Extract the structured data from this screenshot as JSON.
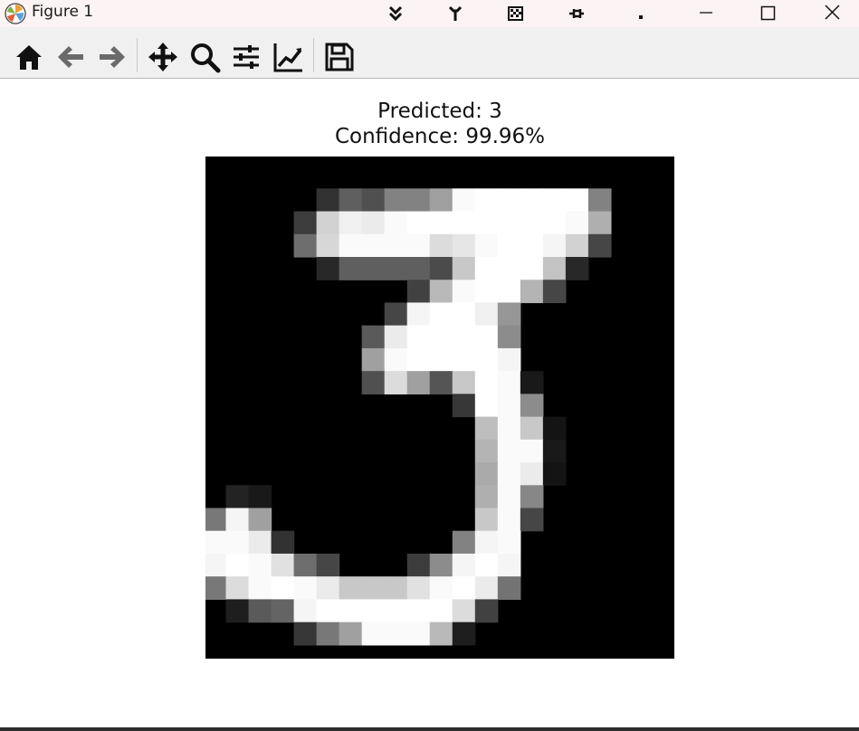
{
  "window": {
    "title": "Figure 1",
    "extra_toolbar_icons": [
      "double-chevron-down-icon",
      "tools-icon",
      "checker-grid-icon",
      "pin-icon",
      "dot-icon"
    ],
    "controls": [
      "minimize-icon",
      "maximize-icon",
      "close-icon"
    ]
  },
  "toolbar": {
    "tools": [
      "home-icon",
      "back-arrow-icon",
      "forward-arrow-icon",
      "pan-icon",
      "zoom-icon",
      "configure-subplots-icon",
      "edit-axis-icon",
      "save-icon"
    ]
  },
  "figure": {
    "title_line1": "Predicted: 3",
    "title_line2": "Confidence: 99.96%",
    "image": {
      "colormap": "gray",
      "rows": [
        "0000000000000000000000000000",
        "0000000000000000000000000000",
        "0000000000000000000000000000",
        "0000000000000000000000000000",
        "0000000000000000000000000000",
        "0000000000000000000000000000",
        "0000000000000000000000000000",
        "0000000000000000000000000000",
        "0000000000000000000000000000",
        "0000000000000000000000000000",
        "0000000000000000000000000000",
        "0000000000000000000000000000",
        "0000000000000000000000000000",
        "0000000000000000000000000000",
        "0000000000000000000000000000",
        "0000000000000000000000000000",
        "0000000000000000000000000000",
        "0000000000000000000000000000",
        "0000000000000000000000000000",
        "0000000000000000000000000000",
        "0000000000000000000000000000",
        "0000000000000000000000000000",
        "0000000000000000000000000000",
        "0000000000000000000000000000",
        "0000000000000000000000000000",
        "0000000000000000000000000000",
        "0000000000000000000000000000",
        "0000000000000000000000000000"
      ],
      "pixels": [
        {
          "r": 1,
          "c": 5,
          "v": 50
        },
        {
          "r": 1,
          "c": 6,
          "v": 95
        },
        {
          "r": 1,
          "c": 7,
          "v": 80
        },
        {
          "r": 1,
          "c": 8,
          "v": 130
        },
        {
          "r": 1,
          "c": 9,
          "v": 130
        },
        {
          "r": 1,
          "c": 10,
          "v": 160
        },
        {
          "r": 1,
          "c": 11,
          "v": 250
        },
        {
          "r": 1,
          "c": 12,
          "v": 255
        },
        {
          "r": 1,
          "c": 13,
          "v": 255
        },
        {
          "r": 1,
          "c": 14,
          "v": 255
        },
        {
          "r": 1,
          "c": 15,
          "v": 255
        },
        {
          "r": 1,
          "c": 16,
          "v": 255
        },
        {
          "r": 1,
          "c": 17,
          "v": 130
        },
        {
          "r": 2,
          "c": 4,
          "v": 60
        },
        {
          "r": 2,
          "c": 5,
          "v": 210
        },
        {
          "r": 2,
          "c": 6,
          "v": 240
        },
        {
          "r": 2,
          "c": 7,
          "v": 235
        },
        {
          "r": 2,
          "c": 8,
          "v": 250
        },
        {
          "r": 2,
          "c": 9,
          "v": 255
        },
        {
          "r": 2,
          "c": 10,
          "v": 255
        },
        {
          "r": 2,
          "c": 11,
          "v": 255
        },
        {
          "r": 2,
          "c": 12,
          "v": 255
        },
        {
          "r": 2,
          "c": 13,
          "v": 255
        },
        {
          "r": 2,
          "c": 14,
          "v": 255
        },
        {
          "r": 2,
          "c": 15,
          "v": 255
        },
        {
          "r": 2,
          "c": 16,
          "v": 250
        },
        {
          "r": 2,
          "c": 17,
          "v": 175
        },
        {
          "r": 3,
          "c": 4,
          "v": 110
        },
        {
          "r": 3,
          "c": 5,
          "v": 215
        },
        {
          "r": 3,
          "c": 6,
          "v": 250
        },
        {
          "r": 3,
          "c": 7,
          "v": 250
        },
        {
          "r": 3,
          "c": 8,
          "v": 250
        },
        {
          "r": 3,
          "c": 9,
          "v": 250
        },
        {
          "r": 3,
          "c": 10,
          "v": 220
        },
        {
          "r": 3,
          "c": 11,
          "v": 230
        },
        {
          "r": 3,
          "c": 12,
          "v": 250
        },
        {
          "r": 3,
          "c": 13,
          "v": 255
        },
        {
          "r": 3,
          "c": 14,
          "v": 255
        },
        {
          "r": 3,
          "c": 15,
          "v": 245
        },
        {
          "r": 3,
          "c": 16,
          "v": 210
        },
        {
          "r": 3,
          "c": 17,
          "v": 70
        },
        {
          "r": 4,
          "c": 5,
          "v": 40
        },
        {
          "r": 4,
          "c": 6,
          "v": 95
        },
        {
          "r": 4,
          "c": 7,
          "v": 95
        },
        {
          "r": 4,
          "c": 8,
          "v": 95
        },
        {
          "r": 4,
          "c": 9,
          "v": 95
        },
        {
          "r": 4,
          "c": 10,
          "v": 75
        },
        {
          "r": 4,
          "c": 11,
          "v": 200
        },
        {
          "r": 4,
          "c": 12,
          "v": 255
        },
        {
          "r": 4,
          "c": 13,
          "v": 255
        },
        {
          "r": 4,
          "c": 14,
          "v": 255
        },
        {
          "r": 4,
          "c": 15,
          "v": 195
        },
        {
          "r": 4,
          "c": 16,
          "v": 40
        },
        {
          "r": 5,
          "c": 9,
          "v": 65
        },
        {
          "r": 5,
          "c": 10,
          "v": 185
        },
        {
          "r": 5,
          "c": 11,
          "v": 250
        },
        {
          "r": 5,
          "c": 12,
          "v": 255
        },
        {
          "r": 5,
          "c": 13,
          "v": 255
        },
        {
          "r": 5,
          "c": 14,
          "v": 180
        },
        {
          "r": 5,
          "c": 15,
          "v": 70
        },
        {
          "r": 6,
          "c": 8,
          "v": 70
        },
        {
          "r": 6,
          "c": 9,
          "v": 245
        },
        {
          "r": 6,
          "c": 10,
          "v": 255
        },
        {
          "r": 6,
          "c": 11,
          "v": 255
        },
        {
          "r": 6,
          "c": 12,
          "v": 240
        },
        {
          "r": 6,
          "c": 13,
          "v": 150
        },
        {
          "r": 7,
          "c": 7,
          "v": 90
        },
        {
          "r": 7,
          "c": 8,
          "v": 235
        },
        {
          "r": 7,
          "c": 9,
          "v": 255
        },
        {
          "r": 7,
          "c": 10,
          "v": 255
        },
        {
          "r": 7,
          "c": 11,
          "v": 255
        },
        {
          "r": 7,
          "c": 12,
          "v": 255
        },
        {
          "r": 7,
          "c": 13,
          "v": 140
        },
        {
          "r": 8,
          "c": 7,
          "v": 160
        },
        {
          "r": 8,
          "c": 8,
          "v": 250
        },
        {
          "r": 8,
          "c": 9,
          "v": 255
        },
        {
          "r": 8,
          "c": 10,
          "v": 255
        },
        {
          "r": 8,
          "c": 11,
          "v": 255
        },
        {
          "r": 8,
          "c": 12,
          "v": 255
        },
        {
          "r": 8,
          "c": 13,
          "v": 245
        },
        {
          "r": 9,
          "c": 7,
          "v": 80
        },
        {
          "r": 9,
          "c": 8,
          "v": 220
        },
        {
          "r": 9,
          "c": 9,
          "v": 160
        },
        {
          "r": 9,
          "c": 10,
          "v": 85
        },
        {
          "r": 9,
          "c": 11,
          "v": 200
        },
        {
          "r": 9,
          "c": 12,
          "v": 255
        },
        {
          "r": 9,
          "c": 13,
          "v": 250
        },
        {
          "r": 9,
          "c": 14,
          "v": 25
        },
        {
          "r": 10,
          "c": 11,
          "v": 55
        },
        {
          "r": 10,
          "c": 12,
          "v": 255
        },
        {
          "r": 10,
          "c": 13,
          "v": 250
        },
        {
          "r": 10,
          "c": 14,
          "v": 140
        },
        {
          "r": 11,
          "c": 12,
          "v": 190
        },
        {
          "r": 11,
          "c": 13,
          "v": 250
        },
        {
          "r": 11,
          "c": 14,
          "v": 200
        },
        {
          "r": 11,
          "c": 15,
          "v": 20
        },
        {
          "r": 12,
          "c": 12,
          "v": 180
        },
        {
          "r": 12,
          "c": 13,
          "v": 250
        },
        {
          "r": 12,
          "c": 14,
          "v": 250
        },
        {
          "r": 12,
          "c": 15,
          "v": 25
        },
        {
          "r": 13,
          "c": 12,
          "v": 170
        },
        {
          "r": 13,
          "c": 13,
          "v": 250
        },
        {
          "r": 13,
          "c": 14,
          "v": 235
        },
        {
          "r": 13,
          "c": 15,
          "v": 20
        },
        {
          "r": 14,
          "c": 1,
          "v": 35
        },
        {
          "r": 14,
          "c": 2,
          "v": 25
        },
        {
          "r": 14,
          "c": 12,
          "v": 175
        },
        {
          "r": 14,
          "c": 13,
          "v": 250
        },
        {
          "r": 14,
          "c": 14,
          "v": 135
        },
        {
          "r": 15,
          "c": 0,
          "v": 120
        },
        {
          "r": 15,
          "c": 1,
          "v": 245
        },
        {
          "r": 15,
          "c": 2,
          "v": 160
        },
        {
          "r": 15,
          "c": 12,
          "v": 200
        },
        {
          "r": 15,
          "c": 13,
          "v": 250
        },
        {
          "r": 15,
          "c": 14,
          "v": 70
        },
        {
          "r": 16,
          "c": 0,
          "v": 250
        },
        {
          "r": 16,
          "c": 1,
          "v": 250
        },
        {
          "r": 16,
          "c": 2,
          "v": 235
        },
        {
          "r": 16,
          "c": 3,
          "v": 50
        },
        {
          "r": 16,
          "c": 11,
          "v": 130
        },
        {
          "r": 16,
          "c": 12,
          "v": 245
        },
        {
          "r": 16,
          "c": 13,
          "v": 250
        },
        {
          "r": 17,
          "c": 0,
          "v": 245
        },
        {
          "r": 17,
          "c": 1,
          "v": 255
        },
        {
          "r": 17,
          "c": 2,
          "v": 250
        },
        {
          "r": 17,
          "c": 3,
          "v": 225
        },
        {
          "r": 17,
          "c": 4,
          "v": 110
        },
        {
          "r": 17,
          "c": 5,
          "v": 70
        },
        {
          "r": 17,
          "c": 9,
          "v": 60
        },
        {
          "r": 17,
          "c": 10,
          "v": 140
        },
        {
          "r": 17,
          "c": 11,
          "v": 245
        },
        {
          "r": 17,
          "c": 12,
          "v": 255
        },
        {
          "r": 17,
          "c": 13,
          "v": 245
        },
        {
          "r": 18,
          "c": 0,
          "v": 120
        },
        {
          "r": 18,
          "c": 1,
          "v": 220
        },
        {
          "r": 18,
          "c": 2,
          "v": 250
        },
        {
          "r": 18,
          "c": 3,
          "v": 255
        },
        {
          "r": 18,
          "c": 4,
          "v": 250
        },
        {
          "r": 18,
          "c": 5,
          "v": 235
        },
        {
          "r": 18,
          "c": 6,
          "v": 200
        },
        {
          "r": 18,
          "c": 7,
          "v": 200
        },
        {
          "r": 18,
          "c": 8,
          "v": 200
        },
        {
          "r": 18,
          "c": 9,
          "v": 225
        },
        {
          "r": 18,
          "c": 10,
          "v": 250
        },
        {
          "r": 18,
          "c": 11,
          "v": 255
        },
        {
          "r": 18,
          "c": 12,
          "v": 235
        },
        {
          "r": 18,
          "c": 13,
          "v": 115
        },
        {
          "r": 19,
          "c": 1,
          "v": 30
        },
        {
          "r": 19,
          "c": 2,
          "v": 90
        },
        {
          "r": 19,
          "c": 3,
          "v": 100
        },
        {
          "r": 19,
          "c": 4,
          "v": 245
        },
        {
          "r": 19,
          "c": 5,
          "v": 255
        },
        {
          "r": 19,
          "c": 6,
          "v": 255
        },
        {
          "r": 19,
          "c": 7,
          "v": 255
        },
        {
          "r": 19,
          "c": 8,
          "v": 255
        },
        {
          "r": 19,
          "c": 9,
          "v": 255
        },
        {
          "r": 19,
          "c": 10,
          "v": 255
        },
        {
          "r": 19,
          "c": 11,
          "v": 220
        },
        {
          "r": 19,
          "c": 12,
          "v": 65
        },
        {
          "r": 20,
          "c": 4,
          "v": 55
        },
        {
          "r": 20,
          "c": 5,
          "v": 120
        },
        {
          "r": 20,
          "c": 6,
          "v": 160
        },
        {
          "r": 20,
          "c": 7,
          "v": 250
        },
        {
          "r": 20,
          "c": 8,
          "v": 250
        },
        {
          "r": 20,
          "c": 9,
          "v": 250
        },
        {
          "r": 20,
          "c": 10,
          "v": 185
        },
        {
          "r": 20,
          "c": 11,
          "v": 30
        }
      ]
    }
  }
}
